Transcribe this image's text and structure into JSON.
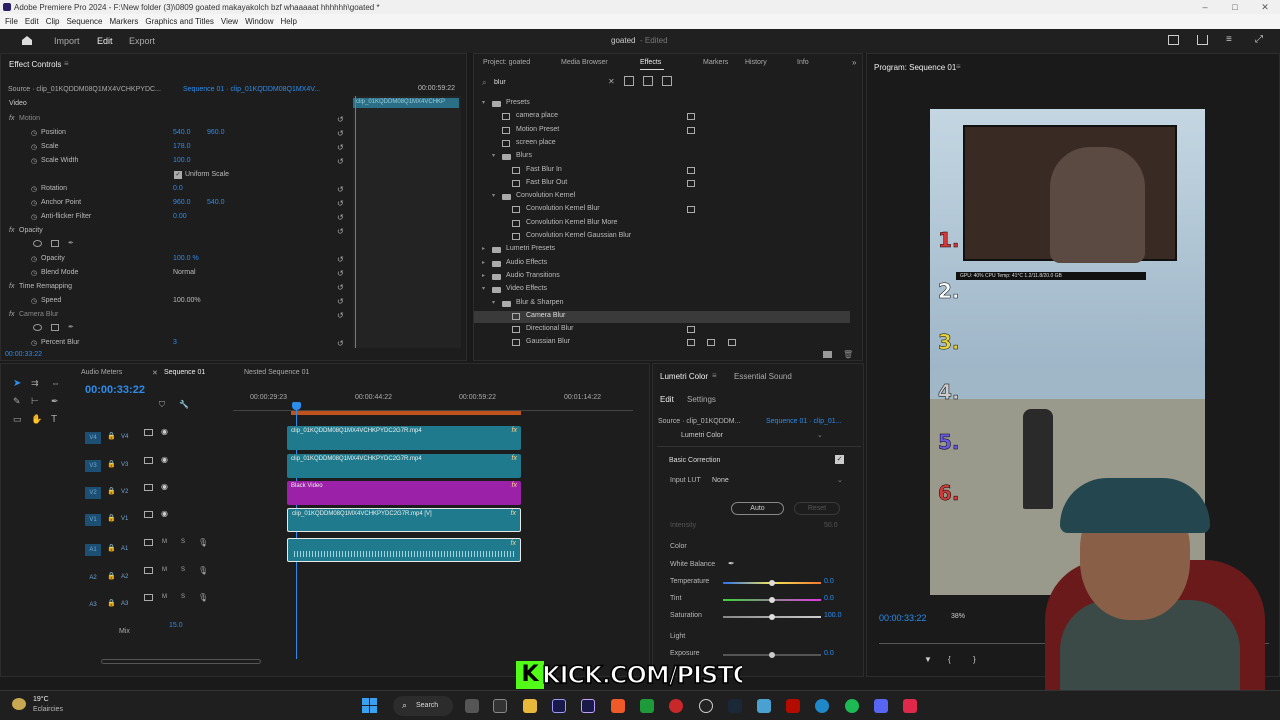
{
  "app": {
    "title": "Adobe Premiere Pro 2024 - F:\\New folder (3)\\0809 goated makayakolch bzf whaaaaat hhhhhh\\goated *"
  },
  "menu": [
    "File",
    "Edit",
    "Clip",
    "Sequence",
    "Markers",
    "Graphics and Titles",
    "View",
    "Window",
    "Help"
  ],
  "header": {
    "tabs": [
      "Import",
      "Edit",
      "Export"
    ],
    "project": "goated",
    "status": "- Edited"
  },
  "effect_controls": {
    "tab": "Effect Controls",
    "source": "Source · clip_01KQDDM08Q1MX4VCHKPYDC...",
    "sequence": "Sequence 01 · clip_01KQDDM08Q1MX4V...",
    "timecode_right": "00:00:59:22",
    "clip_label": "clip_01KQDDM08Q1MX4VCHKP",
    "section": "Video",
    "rows": [
      {
        "label": "Motion",
        "value": "",
        "value2": ""
      },
      {
        "label": "Position",
        "value": "540.0",
        "value2": "960.0"
      },
      {
        "label": "Scale",
        "value": "178.0",
        "value2": ""
      },
      {
        "label": "Scale Width",
        "value": "100.0",
        "value2": ""
      },
      {
        "label": "",
        "value": "Uniform Scale",
        "value2": ""
      },
      {
        "label": "Rotation",
        "value": "0.0",
        "value2": ""
      },
      {
        "label": "Anchor Point",
        "value": "960.0",
        "value2": "540.0"
      },
      {
        "label": "Anti-flicker Filter",
        "value": "0.00",
        "value2": ""
      },
      {
        "label": "Opacity",
        "value": "",
        "value2": ""
      },
      {
        "label": "",
        "value": "",
        "value2": ""
      },
      {
        "label": "Opacity",
        "value": "100.0 %",
        "value2": ""
      },
      {
        "label": "Blend Mode",
        "value": "Normal",
        "value2": ""
      },
      {
        "label": "Time Remapping",
        "value": "",
        "value2": ""
      },
      {
        "label": "Speed",
        "value": "100.00%",
        "value2": ""
      },
      {
        "label": "Camera Blur",
        "value": "",
        "value2": ""
      },
      {
        "label": "",
        "value": "",
        "value2": ""
      },
      {
        "label": "Percent Blur",
        "value": "3",
        "value2": ""
      }
    ],
    "bottom_time": "00:00:33:22"
  },
  "effects": {
    "tabs": [
      "Project: goated",
      "Media Browser",
      "Effects",
      "Markers",
      "History",
      "Info"
    ],
    "search": "blur",
    "tree": [
      {
        "label": "Presets",
        "level": 0,
        "folder": true
      },
      {
        "label": "camera place",
        "level": 1,
        "folder": false
      },
      {
        "label": "Motion Preset",
        "level": 1,
        "folder": false
      },
      {
        "label": "screen place",
        "level": 1,
        "folder": false
      },
      {
        "label": "Blurs",
        "level": 1,
        "folder": true
      },
      {
        "label": "Fast Blur In",
        "level": 2,
        "folder": false
      },
      {
        "label": "Fast Blur Out",
        "level": 2,
        "folder": false
      },
      {
        "label": "Convolution Kernel",
        "level": 1,
        "folder": true
      },
      {
        "label": "Convolution Kernel Blur",
        "level": 2,
        "folder": false
      },
      {
        "label": "Convolution Kernel Blur More",
        "level": 2,
        "folder": false
      },
      {
        "label": "Convolution Kernel Gaussian Blur",
        "level": 2,
        "folder": false
      },
      {
        "label": "Lumetri Presets",
        "level": 0,
        "folder": true
      },
      {
        "label": "Audio Effects",
        "level": 0,
        "folder": true
      },
      {
        "label": "Audio Transitions",
        "level": 0,
        "folder": true
      },
      {
        "label": "Video Effects",
        "level": 0,
        "folder": true
      },
      {
        "label": "Blur & Sharpen",
        "level": 1,
        "folder": true
      },
      {
        "label": "Camera Blur",
        "level": 2,
        "folder": false
      },
      {
        "label": "Directional Blur",
        "level": 2,
        "folder": false
      },
      {
        "label": "Gaussian Blur",
        "level": 2,
        "folder": false
      }
    ]
  },
  "program": {
    "title": "Program: Sequence 01",
    "timecode": "00:00:33:22",
    "zoom": "38%",
    "overlay": "GPU: 40%   CPU Temp: 41°C   1.2/11.8/20.0 GB",
    "numbers": [
      "1.",
      "2.",
      "3.",
      "4.",
      "5.",
      "6."
    ],
    "number_colors": [
      "#d23a3a",
      "#ffffff",
      "#e8d23a",
      "#cccccc",
      "#6a5ae0",
      "#d23a3a"
    ]
  },
  "timeline": {
    "tabs": [
      "Audio Meters",
      "Sequence 01",
      "Nested Sequence 01"
    ],
    "timecode": "00:00:33:22",
    "ruler": [
      "00:00:29:23",
      "00:00:44:22",
      "00:00:59:22",
      "00:01:14:22"
    ],
    "tracks": [
      {
        "name": "V4",
        "clip": "clip_01KQDDM08Q1MX4VCHKPYDC2G7R.mp4",
        "color": "#1e7a8c"
      },
      {
        "name": "V3",
        "clip": "clip_01KQDDM08Q1MX4VCHKPYDC2G7R.mp4",
        "color": "#1e7a8c"
      },
      {
        "name": "V2",
        "clip": "Black Video",
        "color": "#9b22a8"
      },
      {
        "name": "V1",
        "clip": "clip_01KQDDM08Q1MX4VCHKPYDC2G7R.mp4 [V]",
        "color": "#1e7a8c"
      },
      {
        "name": "A1",
        "clip": "",
        "color": "#1e7a8c"
      },
      {
        "name": "A2",
        "clip": "",
        "color": ""
      },
      {
        "name": "A3",
        "clip": "",
        "color": ""
      }
    ],
    "mix_label": "Mix",
    "mix_value": "15.0"
  },
  "lumetri": {
    "tabs": [
      "Lumetri Color",
      "Essential Sound"
    ],
    "subtabs": [
      "Edit",
      "Settings"
    ],
    "source": "Source · clip_01KQDDM...",
    "sequence": "Sequence 01 · clip_01...",
    "effect": "Lumetri Color",
    "basic": "Basic Correction",
    "input_lut_label": "Input LUT",
    "input_lut": "None",
    "auto": "Auto",
    "reset": "Reset",
    "intensity_label": "Intensity",
    "intensity": "50.0",
    "color_section": "Color",
    "white_balance": "White Balance",
    "sliders": [
      {
        "label": "Temperature",
        "value": "0.0"
      },
      {
        "label": "Tint",
        "value": "0.0"
      },
      {
        "label": "Saturation",
        "value": "100.0"
      }
    ],
    "light_section": "Light",
    "exposure": {
      "label": "Exposure",
      "value": "0.0"
    }
  },
  "watermark": "KICK.COM/PISTOON",
  "taskbar": {
    "temp": "19°C",
    "weather": "Eclaircies",
    "search": "Search"
  }
}
